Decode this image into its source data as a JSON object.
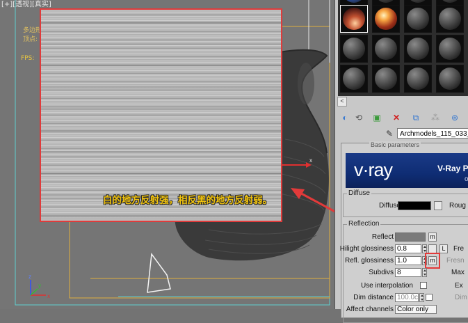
{
  "viewport": {
    "label": "[+][透视][真实]",
    "stats_line1": "多边形",
    "stats_line2": "顶点:",
    "fps": "FPS:",
    "caption": "白的地方反射强，相反黑的地方反射弱。",
    "gizmo_x": "x",
    "axis_x": "x",
    "axis_y": "y",
    "axis_z": "z"
  },
  "material_editor": {
    "scroll_left": "<",
    "material_name": "Archmodels_115_033_0",
    "rollout_title": "Basic parameters",
    "banner": {
      "logo": "v·ray",
      "title": "V-Ray P",
      "subtitle": "op"
    },
    "diffuse": {
      "group": "Diffuse",
      "diffuse_label": "Diffuse",
      "diffuse_color": "#000000",
      "rough_label": "Roug"
    },
    "reflection": {
      "group": "Reflection",
      "reflect_label": "Reflect",
      "reflect_color": "#7a7a7a",
      "reflect_map": "m",
      "hilight_label": "Hilight glossiness",
      "hilight_value": "0.8",
      "hilight_lock": "L",
      "fresnel_label": "Fre",
      "refl_gloss_label": "Refl. glossiness",
      "refl_gloss_value": "1.0",
      "refl_gloss_map": "m",
      "fresnel_ior_label": "Fresn",
      "subdivs_label": "Subdivs",
      "subdivs_value": "8",
      "max_depth_label": "Max",
      "use_interp_label": "Use interpolation",
      "exit_label": "Ex",
      "dim_distance_label": "Dim distance",
      "dim_distance_value": "100.0c",
      "dim_label": "Dim",
      "affect_channels_label": "Affect channels",
      "affect_channels_value": "Color only"
    }
  },
  "colors": {
    "highlight": "#e23a3a",
    "caption": "#f1c30e"
  }
}
